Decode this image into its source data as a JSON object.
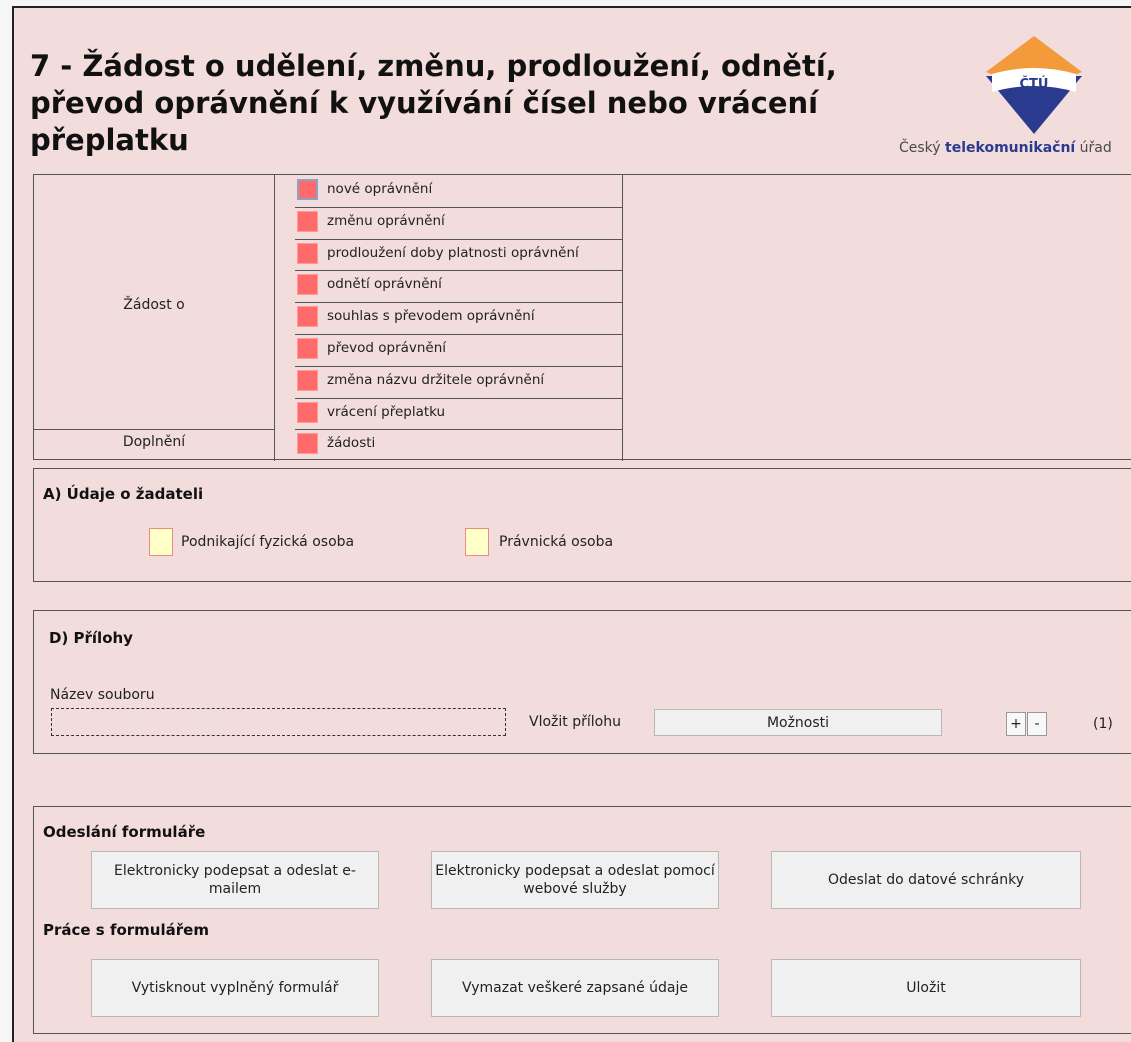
{
  "title": "7 - Žádost o udělení, změnu, prodloužení, odnětí, převod oprávnění k využívání čísel nebo vrácení přeplatku",
  "logo": {
    "emblem_text": "ČTÚ",
    "caption_prefix": "Český ",
    "caption_bold": "telekomunikační",
    "caption_suffix": " úřad",
    "colors": {
      "orange": "#f39a3a",
      "blue": "#2a3b8f"
    }
  },
  "request": {
    "label": "Žádost o",
    "options": [
      "nové oprávnění",
      "změnu oprávnění",
      "prodloužení doby platnosti oprávnění",
      "odnětí oprávnění",
      "souhlas s převodem oprávnění",
      "převod oprávnění",
      "změna názvu držitele oprávnění",
      "vrácení přeplatku"
    ],
    "supplement_label": "Doplnění",
    "supplement_option": "žádosti"
  },
  "applicant": {
    "title": "A) Údaje o žadateli",
    "options": [
      "Podnikající fyzická osoba",
      "Právnická osoba"
    ]
  },
  "attachments": {
    "title": "D) Přílohy",
    "filename_label": "Název souboru",
    "insert_label": "Vložit přílohu",
    "options_button": "Možnosti",
    "plus": "+",
    "minus": "-",
    "count": "(1)"
  },
  "submit": {
    "title": "Odeslání formuláře",
    "buttons": [
      "Elektronicky podepsat a odeslat e-mailem",
      "Elektronicky podepsat a odeslat pomocí webové služby",
      "Odeslat do datové schránky"
    ]
  },
  "form_work": {
    "title": "Práce s formulářem",
    "buttons": [
      "Vytisknout vyplněný formulář",
      "Vymazat veškeré zapsané údaje",
      "Uložit"
    ]
  }
}
